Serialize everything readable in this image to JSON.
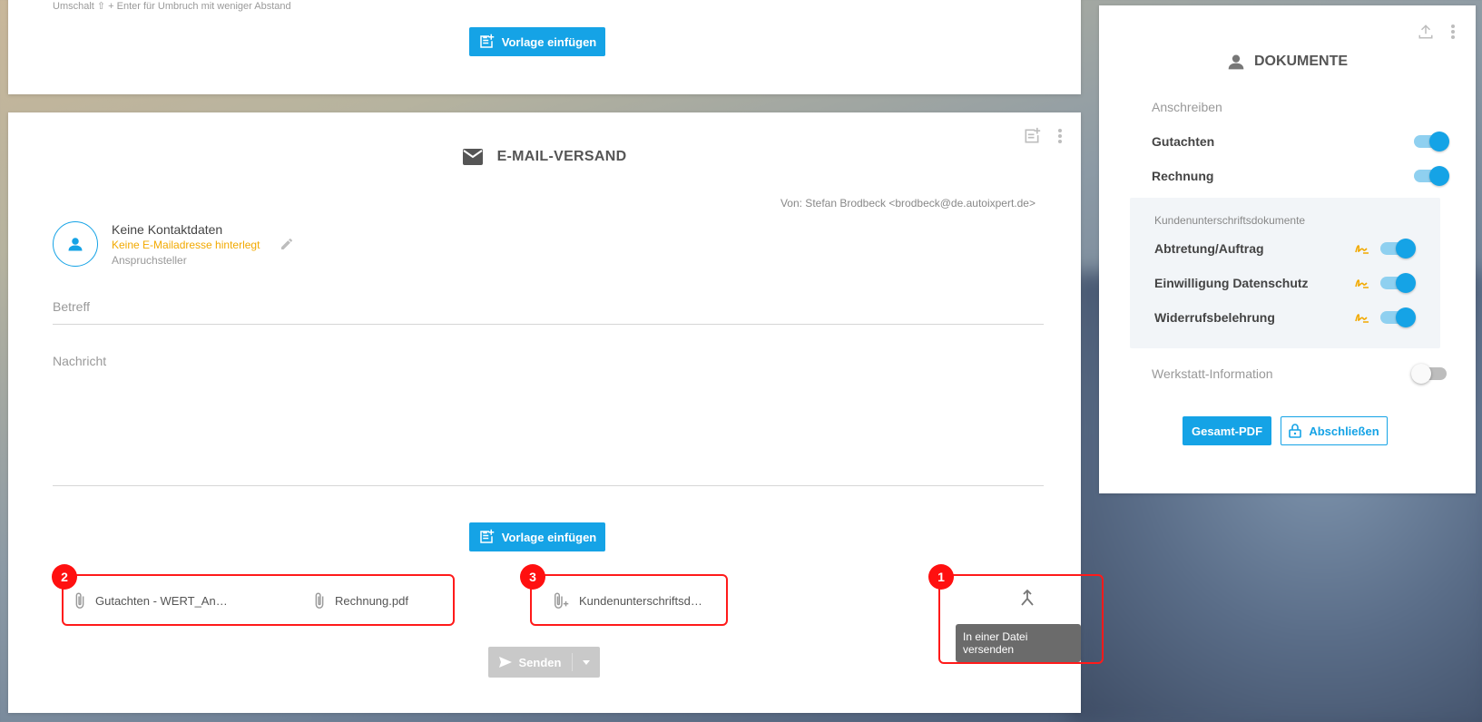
{
  "top_card": {
    "hint": "Umschalt ⇧ + Enter für Umbruch mit weniger Abstand",
    "insert_template_label": "Vorlage einfügen"
  },
  "mail": {
    "title": "E-MAIL-VERSAND",
    "from": "Von: Stefan Brodbeck <brodbeck@de.autoixpert.de>",
    "contact": {
      "name": "Keine Kontaktdaten",
      "warning": "Keine E-Mailadresse hinterlegt",
      "role": "Anspruchsteller"
    },
    "subject_label": "Betreff",
    "message_label": "Nachricht",
    "insert_template_label": "Vorlage einfügen",
    "attachments": {
      "group1": [
        "Gutachten - WERT_An…",
        "Rechnung.pdf"
      ],
      "group2": [
        "Kundenunterschriftsd…"
      ]
    },
    "merge_tooltip": "In einer Datei versenden",
    "send_label": "Senden",
    "badges": [
      "1",
      "2",
      "3"
    ]
  },
  "docs": {
    "title": "DOKUMENTE",
    "cover_letter": "Anschreiben",
    "items": [
      {
        "label": "Gutachten",
        "enabled": true
      },
      {
        "label": "Rechnung",
        "enabled": true
      }
    ],
    "signature_group_label": "Kundenunterschriftsdokumente",
    "signature_items": [
      {
        "label": "Abtretung/Auftrag",
        "enabled": true
      },
      {
        "label": "Einwilligung Datenschutz",
        "enabled": true
      },
      {
        "label": "Widerrufsbelehrung",
        "enabled": true
      }
    ],
    "workshop": {
      "label": "Werkstatt-Information",
      "enabled": false
    },
    "pdf_button": "Gesamt-PDF",
    "lock_button": "Abschließen"
  },
  "colors": {
    "accent": "#15a3e6",
    "warning": "#f2a900",
    "highlight": "#ff1a1a"
  }
}
